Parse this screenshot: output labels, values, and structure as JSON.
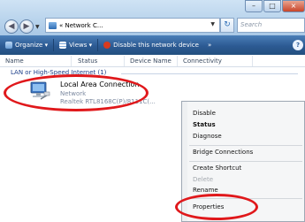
{
  "address": {
    "path": "« Network C...",
    "search_placeholder": "Search"
  },
  "window_controls": {
    "minimize": "–",
    "maximize": "□",
    "close": "×"
  },
  "toolbar": {
    "organize": "Organize ▾",
    "views": "Views ▾",
    "disable": "Disable this network device",
    "more": "»",
    "help": "?"
  },
  "columns": [
    "Name",
    "Status",
    "Device Name",
    "Connectivity"
  ],
  "group_header": "LAN or High-Speed Internet (1)",
  "connection": {
    "name": "Local Area Connection",
    "status": "Network",
    "device": "Realtek RTL8168C(P)/8111C(..."
  },
  "context_menu": {
    "items": [
      {
        "label": "Disable",
        "style": "normal"
      },
      {
        "label": "Status",
        "style": "bold"
      },
      {
        "label": "Diagnose",
        "style": "normal"
      },
      {
        "label": "Bridge Connections",
        "style": "normal"
      },
      {
        "label": "Create Shortcut",
        "style": "normal"
      },
      {
        "label": "Delete",
        "style": "disabled"
      },
      {
        "label": "Rename",
        "style": "normal"
      },
      {
        "label": "Properties",
        "style": "normal"
      }
    ]
  },
  "colors": {
    "toolbar": "#2c5a93",
    "annotation": "#e0181b",
    "menu_bg": "#f5f6f7"
  }
}
